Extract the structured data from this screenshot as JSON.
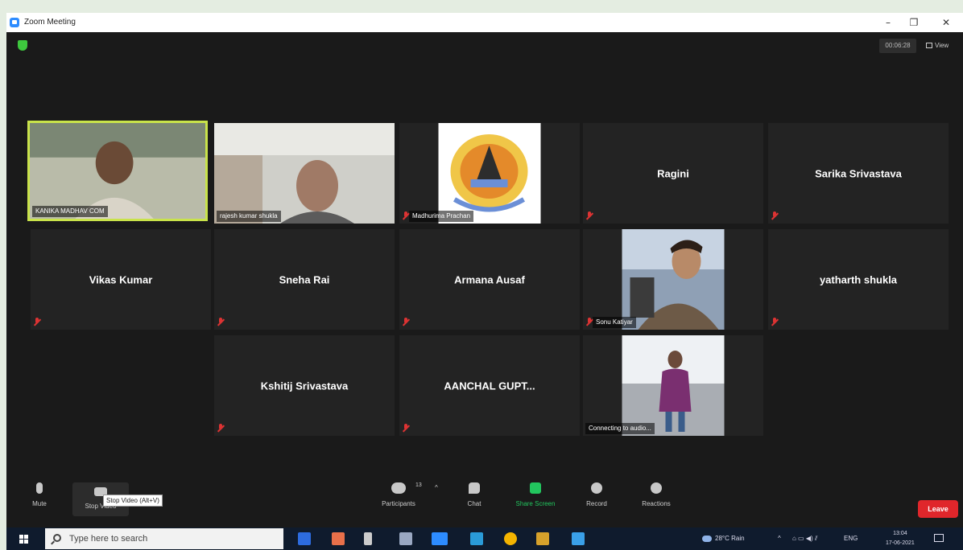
{
  "window": {
    "title": "Zoom Meeting"
  },
  "top_bar": {
    "timer": "00:06:28",
    "view_label": "View"
  },
  "participants": {
    "kanika": {
      "label": "KANIKA MADHAV COM"
    },
    "rajesh": {
      "label": "rajesh kumar shukla"
    },
    "madhurima": {
      "label": "Madhurima Prachan"
    },
    "ragini": {
      "name": "Ragini"
    },
    "sarika": {
      "name": "Sarika Srivastava"
    },
    "vikas": {
      "name": "Vikas Kumar"
    },
    "sneha": {
      "name": "Sneha Rai"
    },
    "armana": {
      "name": "Armana Ausaf"
    },
    "sonu": {
      "label": "Sonu Katiyar"
    },
    "yatharth": {
      "name": "yatharth shukla"
    },
    "kshitij": {
      "name": "Kshitij Srivastava"
    },
    "aanchal": {
      "name": "AANCHAL GUPT..."
    },
    "connecting": {
      "label": "Connecting to audio..."
    }
  },
  "toolbar": {
    "mute": "Mute",
    "stop_video": "Stop Video",
    "stop_video_tooltip": "Stop Video (Alt+V)",
    "participants": "Participants",
    "participants_count": "13",
    "chat": "Chat",
    "share_screen": "Share Screen",
    "record": "Record",
    "reactions": "Reactions",
    "leave": "Leave"
  },
  "taskbar": {
    "search_placeholder": "Type here to search",
    "weather": "28°C Rain",
    "language": "ENG",
    "time": "13:04",
    "date": "17-06-2021"
  },
  "colors": {
    "accent_green": "#c9e34a",
    "leave_red": "#e0262b",
    "share_green": "#22c55e"
  }
}
